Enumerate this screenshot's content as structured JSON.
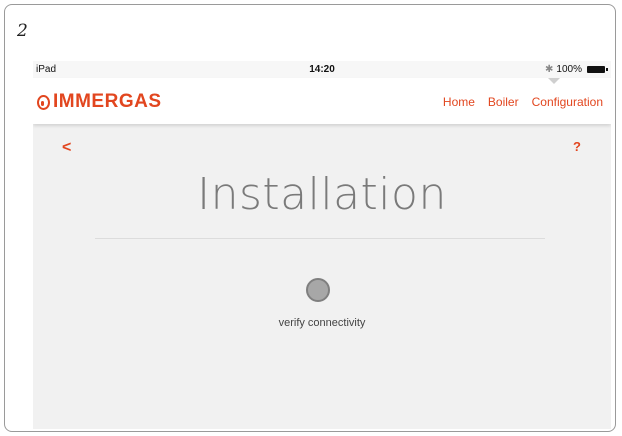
{
  "figure_number": "2",
  "status_bar": {
    "device": "iPad",
    "time": "14:20",
    "battery": "100%"
  },
  "brand": {
    "name": "IMMERGAS",
    "accent_color": "#e2461f"
  },
  "nav": {
    "items": [
      {
        "label": "Home"
      },
      {
        "label": "Boiler"
      },
      {
        "label": "Configuration"
      }
    ]
  },
  "page": {
    "back_icon": "<",
    "help_icon": "?",
    "title": "Installation",
    "action_label": "verify connectivity"
  }
}
